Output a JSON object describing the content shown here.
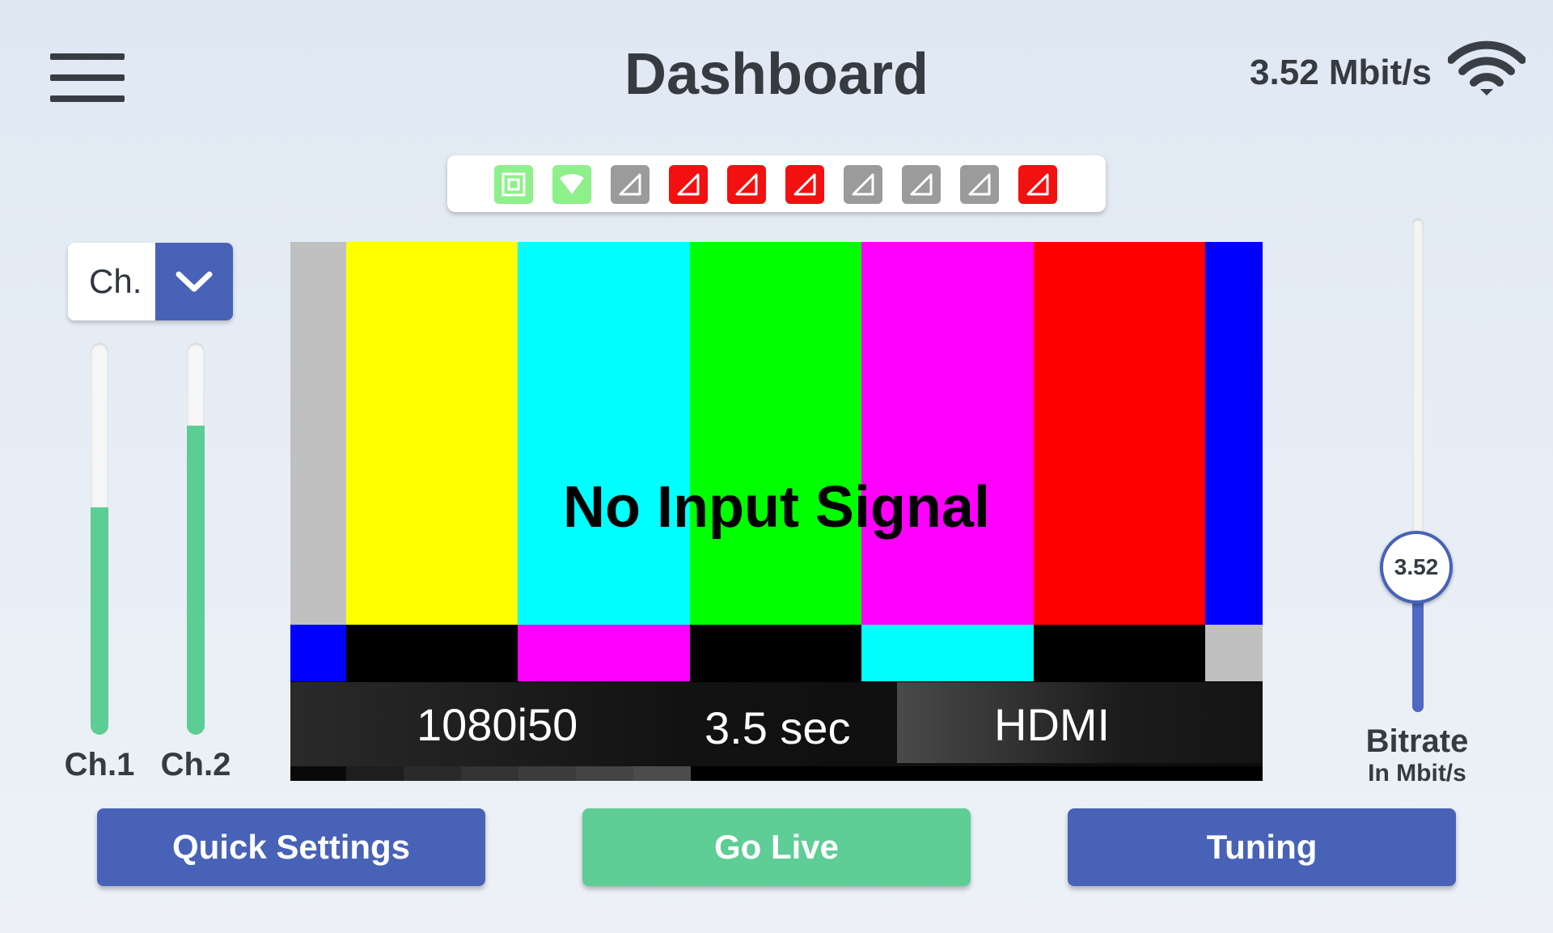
{
  "header": {
    "title": "Dashboard",
    "bitrate_readout": "3.52 Mbit/s"
  },
  "status_icons": [
    {
      "name": "ethernet-icon",
      "color": "#8ef08a"
    },
    {
      "name": "wifi-icon",
      "color": "#8ef08a"
    },
    {
      "name": "cellular-modem-icon",
      "color": "#9b9b9b"
    },
    {
      "name": "cellular-modem-icon",
      "color": "#f21010"
    },
    {
      "name": "cellular-modem-icon",
      "color": "#f21010"
    },
    {
      "name": "cellular-modem-icon",
      "color": "#f21010"
    },
    {
      "name": "cellular-modem-icon",
      "color": "#9b9b9b"
    },
    {
      "name": "cellular-modem-icon",
      "color": "#9b9b9b"
    },
    {
      "name": "cellular-modem-icon",
      "color": "#9b9b9b"
    },
    {
      "name": "cellular-modem-icon",
      "color": "#f21010"
    }
  ],
  "channel_select": {
    "value": "Ch."
  },
  "audio_meters": [
    {
      "label": "Ch.1",
      "level": 0.58
    },
    {
      "label": "Ch.2",
      "level": 0.79
    }
  ],
  "preview": {
    "message": "No Input Signal",
    "resolution": "1080i50",
    "latency": "3.5 sec",
    "input": "HDMI"
  },
  "bitrate_slider": {
    "value": "3.52",
    "level": 0.27,
    "title": "Bitrate",
    "subtitle": "In Mbit/s"
  },
  "actions": {
    "quick_settings": "Quick Settings",
    "go_live": "Go Live",
    "tuning": "Tuning"
  },
  "colors": {
    "accent": "#4762b7",
    "live": "#5ecd96",
    "meter": "#5ccd94",
    "ok": "#8ef08a",
    "error": "#f21010",
    "idle": "#9b9b9b"
  }
}
